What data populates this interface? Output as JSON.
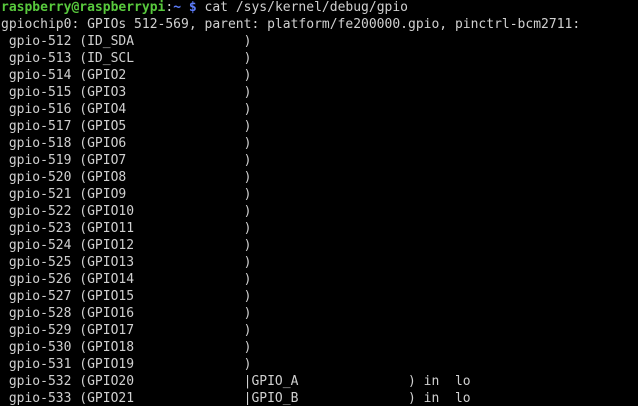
{
  "prompt": {
    "user_host": "raspberry@raspberrypi",
    "separator": ":",
    "path": "~ $",
    "command": " cat /sys/kernel/debug/gpio"
  },
  "header": "gpiochip0: GPIOs 512-569, parent: platform/fe200000.gpio, pinctrl-bcm2711:",
  "lines": [
    " gpio-512 (ID_SDA              )",
    " gpio-513 (ID_SCL              )",
    " gpio-514 (GPIO2               )",
    " gpio-515 (GPIO3               )",
    " gpio-516 (GPIO4               )",
    " gpio-517 (GPIO5               )",
    " gpio-518 (GPIO6               )",
    " gpio-519 (GPIO7               )",
    " gpio-520 (GPIO8               )",
    " gpio-521 (GPIO9               )",
    " gpio-522 (GPIO10              )",
    " gpio-523 (GPIO11              )",
    " gpio-524 (GPIO12              )",
    " gpio-525 (GPIO13              )",
    " gpio-526 (GPIO14              )",
    " gpio-527 (GPIO15              )",
    " gpio-528 (GPIO16              )",
    " gpio-529 (GPIO17              )",
    " gpio-530 (GPIO18              )",
    " gpio-531 (GPIO19              )",
    " gpio-532 (GPIO20              |GPIO_A              ) in  lo",
    " gpio-533 (GPIO21              |GPIO_B              ) in  lo"
  ],
  "colors": {
    "background": "#000000",
    "text": "#d0d0d0",
    "prompt_user": "#58c93d",
    "prompt_path": "#5c7cfa"
  }
}
